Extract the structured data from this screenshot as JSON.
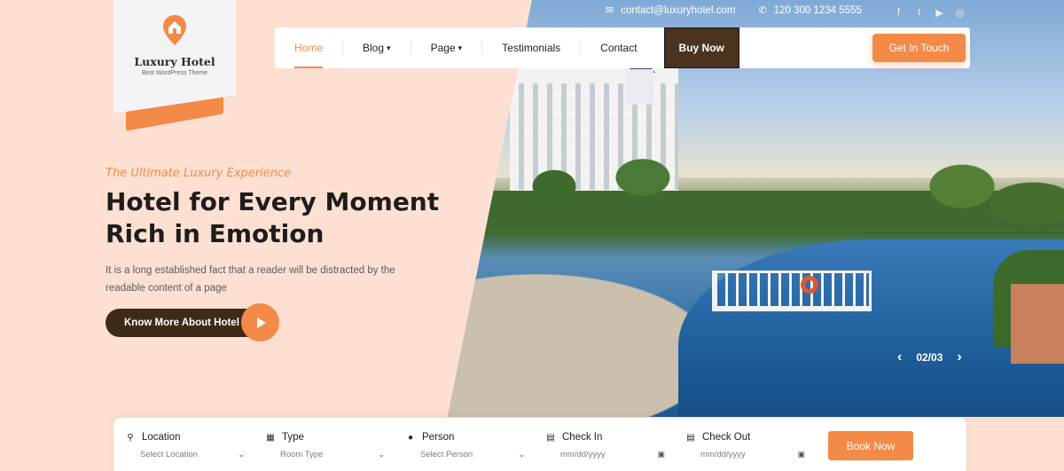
{
  "topbar": {
    "email": "contact@luxuryhotel.com",
    "phone": "120 300 1234 5555",
    "social_icons": [
      "facebook-icon",
      "twitter-icon",
      "youtube-icon",
      "instagram-icon"
    ]
  },
  "logo": {
    "name": "Luxury Hotel",
    "tagline": "Best WordPress Theme",
    "icon": "location-pin-home-icon"
  },
  "nav": {
    "items": [
      {
        "label": "Home",
        "active": true
      },
      {
        "label": "Blog",
        "dropdown": true
      },
      {
        "label": "Page",
        "dropdown": true
      },
      {
        "label": "Testimonials"
      },
      {
        "label": "Contact"
      }
    ],
    "buy_now": "Buy Now",
    "get_in_touch": "Get In Touch"
  },
  "hero": {
    "eyebrow": "The Ultimate Luxury Experience",
    "headline_line1": "Hotel for Every Moment",
    "headline_line2": "Rich in Emotion",
    "description": "It is a long established fact that a reader will be distracted by the readable content of a page",
    "cta_label": "Know More About Hotel",
    "slide_counter": "02/03"
  },
  "booking": {
    "fields": [
      {
        "label": "Location",
        "placeholder": "Select Location",
        "icon": "map-marker-icon",
        "control": "dropdown"
      },
      {
        "label": "Type",
        "placeholder": "Room Type",
        "icon": "building-icon",
        "control": "dropdown"
      },
      {
        "label": "Person",
        "placeholder": "Select Person",
        "icon": "user-icon",
        "control": "dropdown"
      },
      {
        "label": "Check In",
        "placeholder": "mm/dd/yyyy",
        "icon": "calendar-icon",
        "control": "date"
      },
      {
        "label": "Check Out",
        "placeholder": "mm/dd/yyyy",
        "icon": "calendar-icon",
        "control": "date"
      }
    ],
    "submit": "Book Now"
  },
  "colors": {
    "accent": "#f38a47",
    "dark_brown": "#3e2a16",
    "hero_bg": "#fde0d1"
  }
}
